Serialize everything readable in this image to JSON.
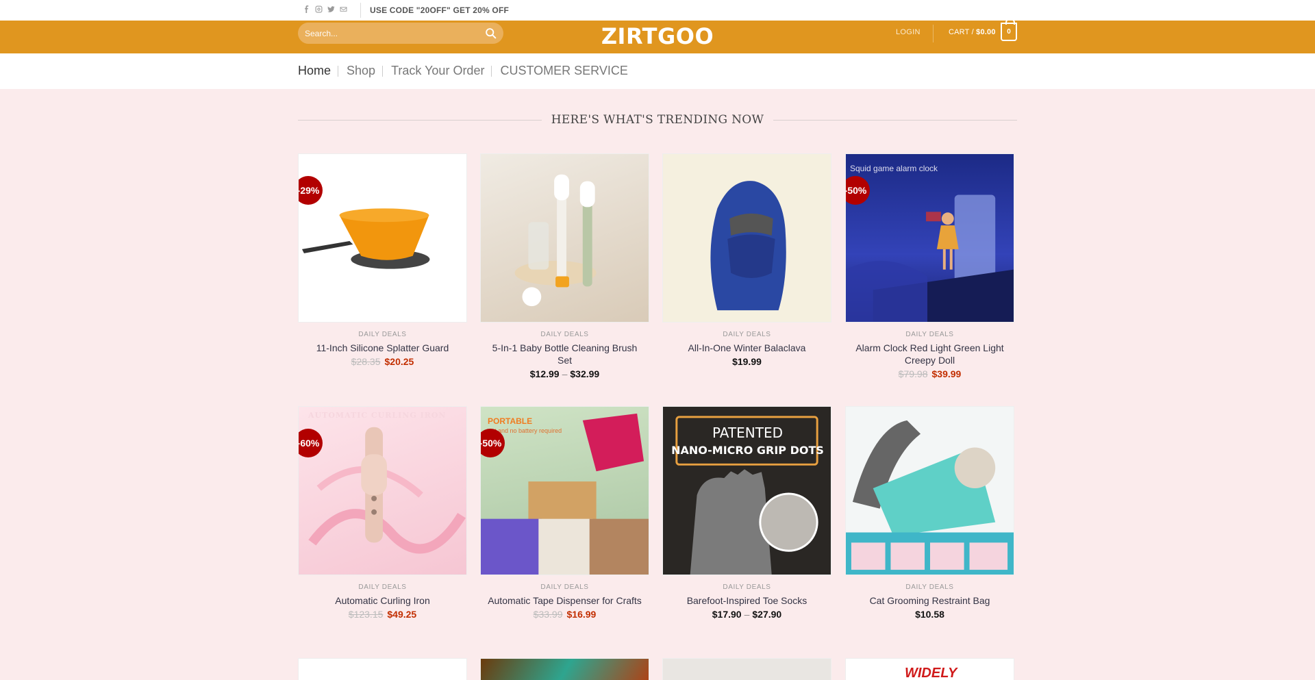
{
  "topbar": {
    "social_icons": [
      "facebook-icon",
      "instagram-icon",
      "twitter-icon",
      "email-icon"
    ],
    "promo": "USE CODE \"20OFF\" GET 20% OFF"
  },
  "header": {
    "search_placeholder": "Search...",
    "logo": "ZIRTGOO",
    "login": "LOGIN",
    "cart_label": "CART /",
    "cart_total": "$0.00",
    "cart_count": "0",
    "brand_color": "#e0961f"
  },
  "nav": {
    "items": [
      "Home",
      "Shop",
      "Track Your Order",
      "CUSTOMER SERVICE"
    ]
  },
  "section": {
    "title": "HERE'S WHAT'S TRENDING NOW"
  },
  "products": [
    {
      "name": "11-Inch Silicone Splatter Guard",
      "category": "DAILY DEALS",
      "badge": "-29%",
      "old_price": "$28.35",
      "price": "$20.25"
    },
    {
      "name": "5-In-1 Baby Bottle Cleaning Brush Set",
      "category": "DAILY DEALS",
      "price_low": "$12.99",
      "price_high": "$32.99"
    },
    {
      "name": "All-In-One Winter Balaclava",
      "category": "DAILY DEALS",
      "price": "$19.99"
    },
    {
      "name": "Alarm Clock Red Light Green Light Creepy Doll",
      "category": "DAILY DEALS",
      "badge": "-50%",
      "old_price": "$79.98",
      "price": "$39.99",
      "image_caption": "Squid game alarm clock"
    },
    {
      "name": "Automatic Curling Iron",
      "category": "DAILY DEALS",
      "badge": "-60%",
      "old_price": "$123.15",
      "price": "$49.25",
      "image_caption": "AUTOMATIC CURLING IRON"
    },
    {
      "name": "Automatic Tape Dispenser for Crafts",
      "category": "DAILY DEALS",
      "badge": "-50%",
      "old_price": "$33.99",
      "price": "$16.99",
      "image_caption": "PORTABLE",
      "image_subcaption": "ent and no battery required"
    },
    {
      "name": "Barefoot-Inspired Toe Socks",
      "category": "DAILY DEALS",
      "price_low": "$17.90",
      "price_high": "$27.90",
      "image_caption": "PATENTED",
      "image_subcaption": "NANO-MICRO GRIP DOTS"
    },
    {
      "name": "Cat Grooming Restraint Bag",
      "category": "DAILY DEALS",
      "price": "$10.58"
    }
  ],
  "next_row_caption": "WIDELY"
}
